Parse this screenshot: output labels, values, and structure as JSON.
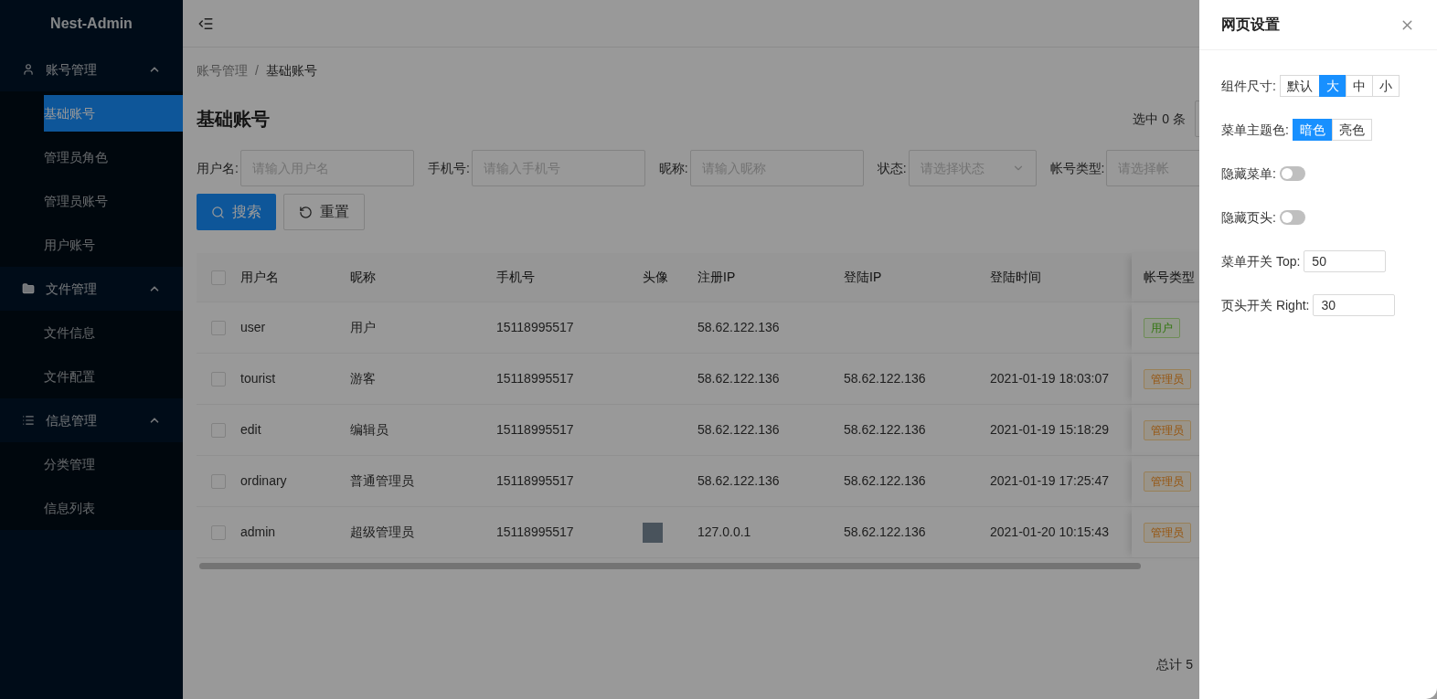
{
  "sidebar": {
    "logo": "Nest-Admin",
    "groups": [
      {
        "label": "账号管理",
        "expanded": true,
        "children": [
          {
            "label": "基础账号",
            "selected": true
          },
          {
            "label": "管理员角色",
            "selected": false
          },
          {
            "label": "管理员账号",
            "selected": false
          },
          {
            "label": "用户账号",
            "selected": false
          }
        ]
      },
      {
        "label": "文件管理",
        "expanded": true,
        "children": [
          {
            "label": "文件信息",
            "selected": false
          },
          {
            "label": "文件配置",
            "selected": false
          }
        ]
      },
      {
        "label": "信息管理",
        "expanded": true,
        "children": [
          {
            "label": "分类管理",
            "selected": false
          },
          {
            "label": "信息列表",
            "selected": false
          }
        ]
      }
    ]
  },
  "breadcrumb": [
    "账号管理",
    "/",
    "基础账号"
  ],
  "page_title": "基础账号",
  "selection_count": "选中 0 条",
  "filters": [
    {
      "label": "用户名:",
      "placeholder": "请输入用户名",
      "kind": "input"
    },
    {
      "label": "手机号:",
      "placeholder": "请输入手机号",
      "kind": "input"
    },
    {
      "label": "昵称:",
      "placeholder": "请输入昵称",
      "kind": "input"
    },
    {
      "label": "状态:",
      "placeholder": "请选择状态",
      "kind": "select"
    },
    {
      "label": "帐号类型:",
      "placeholder": "请选择帐",
      "kind": "input"
    }
  ],
  "buttons": [
    {
      "label": "搜索",
      "kind": "primary"
    },
    {
      "label": "重置",
      "kind": "default"
    }
  ],
  "table": {
    "header_checked": false,
    "columns": [
      "用户名",
      "昵称",
      "手机号",
      "头像",
      "注册IP",
      "登陆IP",
      "登陆时间",
      "帐号类型"
    ],
    "rows": [
      {
        "checked": false,
        "cells": [
          "user",
          "用户",
          "15118995517",
          "",
          "58.62.122.136",
          "",
          ""
        ],
        "has_avatar": false,
        "type": {
          "label": "用户",
          "kind": "user"
        }
      },
      {
        "checked": false,
        "cells": [
          "tourist",
          "游客",
          "15118995517",
          "",
          "58.62.122.136",
          "58.62.122.136",
          "2021-01-19 18:03:07"
        ],
        "has_avatar": false,
        "type": {
          "label": "管理员",
          "kind": "admin"
        }
      },
      {
        "checked": false,
        "cells": [
          "edit",
          "编辑员",
          "15118995517",
          "",
          "58.62.122.136",
          "58.62.122.136",
          "2021-01-19 15:18:29"
        ],
        "has_avatar": false,
        "type": {
          "label": "管理员",
          "kind": "admin"
        }
      },
      {
        "checked": false,
        "cells": [
          "ordinary",
          "普通管理员",
          "15118995517",
          "",
          "58.62.122.136",
          "58.62.122.136",
          "2021-01-19 17:25:47"
        ],
        "has_avatar": false,
        "type": {
          "label": "管理员",
          "kind": "admin"
        }
      },
      {
        "checked": false,
        "cells": [
          "admin",
          "超级管理员",
          "15118995517",
          "",
          "127.0.0.1",
          "58.62.122.136",
          "2021-01-20 10:15:43"
        ],
        "has_avatar": true,
        "type": {
          "label": "管理员",
          "kind": "admin"
        }
      }
    ]
  },
  "pagination": {
    "total": "总计 5"
  },
  "drawer": {
    "title": "网页设置",
    "settings": [
      {
        "kind": "segmented",
        "label": "组件尺寸:",
        "options": [
          {
            "label": "默认",
            "selected": false
          },
          {
            "label": "大",
            "selected": true
          },
          {
            "label": "中",
            "selected": false
          },
          {
            "label": "小",
            "selected": false
          }
        ]
      },
      {
        "kind": "segmented",
        "label": "菜单主题色:",
        "options": [
          {
            "label": "暗色",
            "selected": true
          },
          {
            "label": "亮色",
            "selected": false
          }
        ]
      },
      {
        "kind": "switch",
        "label": "隐藏菜单:",
        "on": false
      },
      {
        "kind": "switch",
        "label": "隐藏页头:",
        "on": false
      },
      {
        "kind": "input",
        "label": "菜单开关 Top:",
        "value": "50"
      },
      {
        "kind": "input",
        "label": "页头开关 Right:",
        "value": "30"
      }
    ]
  }
}
